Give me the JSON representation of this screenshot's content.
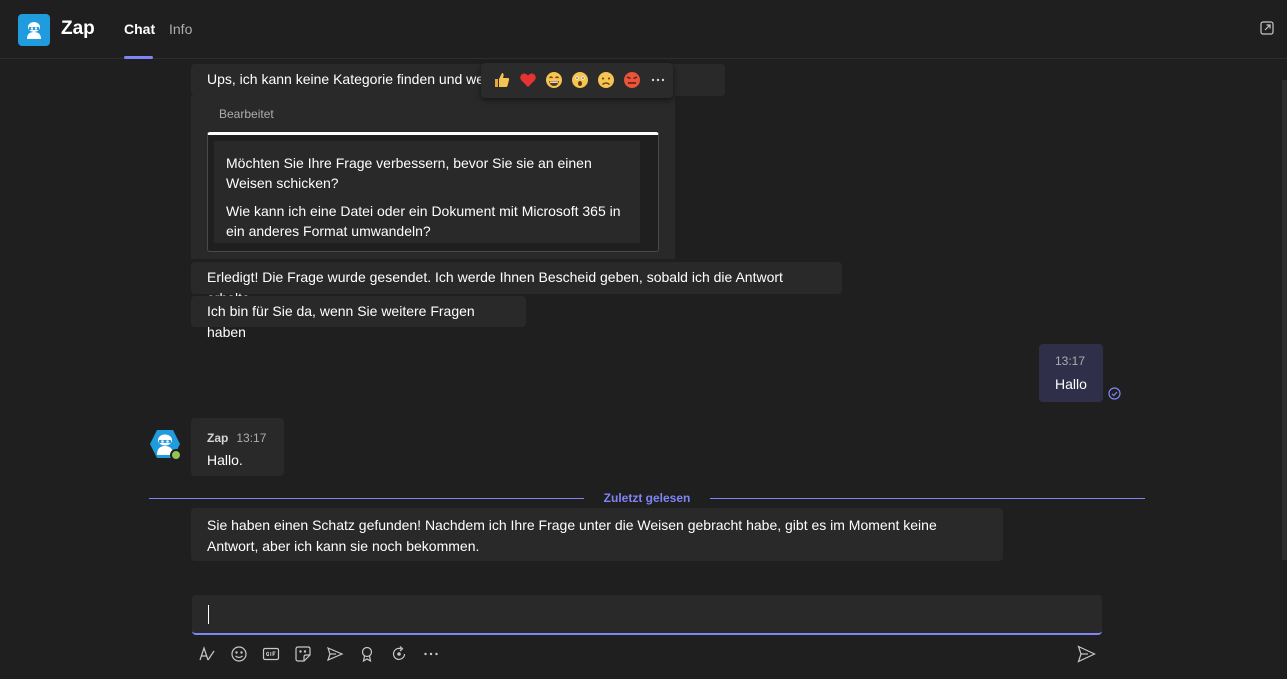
{
  "header": {
    "app_name": "Zap",
    "app_icon": "robot-icon",
    "tabs": [
      {
        "label": "Chat",
        "active": true
      },
      {
        "label": "Info",
        "active": false
      }
    ],
    "popout_icon": "popout-icon"
  },
  "messages": {
    "m1": "Ups, ich kann keine Kategorie finden und weitere Fragen bitten.",
    "edited_label": "Bearbeitet",
    "quote_q1": "Möchten Sie Ihre Frage verbessern, bevor Sie sie an einen Weisen schicken?",
    "quote_q2": "Wie kann ich eine Datei oder ein Dokument mit Microsoft 365 in ein anderes Format umwandeln?",
    "m2": "Erledigt! Die Frage wurde gesendet. Ich werde Ihnen Bescheid geben, sobald ich die Antwort erhalte.",
    "m3": "Ich bin für Sie da, wenn Sie weitere Fragen haben"
  },
  "reactions": [
    "like",
    "heart",
    "laugh",
    "surprised",
    "sad",
    "angry",
    "more"
  ],
  "my_message": {
    "time": "13:17",
    "text": "Hallo"
  },
  "bot_message": {
    "sender": "Zap",
    "time": "13:17",
    "text": "Hallo."
  },
  "last_read": "Zuletzt gelesen",
  "bot_message_2": "Sie haben einen Schatz gefunden! Nachdem ich Ihre Frage unter die Weisen gebracht habe, gibt es im Moment keine Antwort, aber ich kann sie noch bekommen.",
  "compose": {
    "value": "",
    "placeholder": ""
  },
  "toolbar": [
    "format-icon",
    "emoji-icon",
    "gif-icon",
    "sticker-icon",
    "schedule-icon",
    "praise-icon",
    "loop-icon",
    "more-icon"
  ],
  "colors": {
    "accent": "#7f85f5",
    "app_icon_bg": "#1f9bde",
    "bubble": "#292929",
    "my_bubble": "#2f2f4a",
    "presence": "#92c353"
  }
}
